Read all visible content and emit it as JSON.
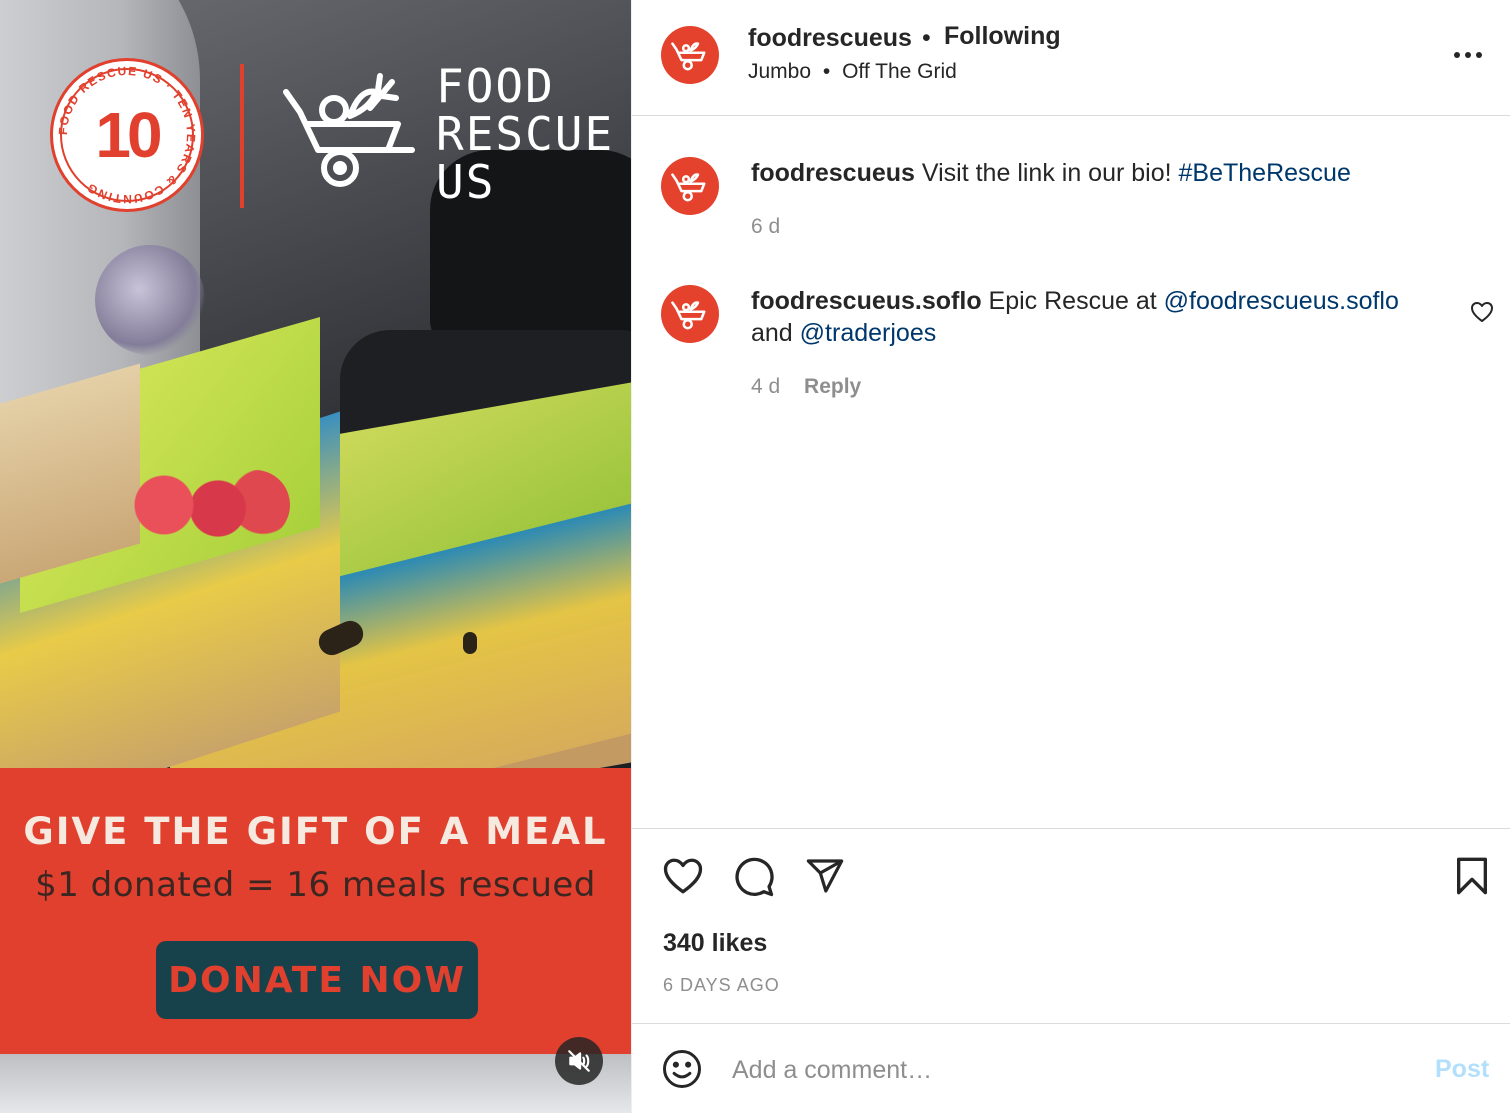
{
  "media": {
    "badge_number": "10",
    "badge_ring_text": "FOOD RESCUE US · TEN YEARS & COUNTING",
    "logo_lines": [
      "FOOD",
      "RESCUE",
      "US"
    ],
    "promo_headline": "GIVE THE GIFT OF A MEAL",
    "promo_sub": "$1 donated = 16 meals rescued",
    "donate_label": "DONATE NOW",
    "mute_icon": "speaker-muted-icon",
    "colors": {
      "brand_red": "#e0402d",
      "button_teal": "#17424c"
    }
  },
  "header": {
    "username": "foodrescueus",
    "dot": "•",
    "follow_status": "Following",
    "location_primary": "Jumbo",
    "location_separator": "•",
    "location_secondary": "Off The Grid",
    "more_icon": "more-options-icon"
  },
  "comments": [
    {
      "username": "foodrescueus",
      "text": "Visit the link in our bio!",
      "hashtag": "#BeTheRescue",
      "time": "6 d"
    },
    {
      "username": "foodrescueus.soflo",
      "text_before": "Epic Rescue at",
      "mention1": "@foodrescueus.soflo",
      "text_middle": "and",
      "mention2": "@traderjoes",
      "time": "4 d",
      "reply_label": "Reply"
    }
  ],
  "actions": {
    "likes": "340 likes",
    "date": "6 DAYS AGO",
    "icons": [
      "heart-icon",
      "comment-icon",
      "share-icon",
      "bookmark-icon"
    ]
  },
  "add_comment": {
    "placeholder": "Add a comment…",
    "post_label": "Post",
    "colors": {
      "post_disabled": "#b2dffc",
      "link": "#00376b"
    }
  }
}
